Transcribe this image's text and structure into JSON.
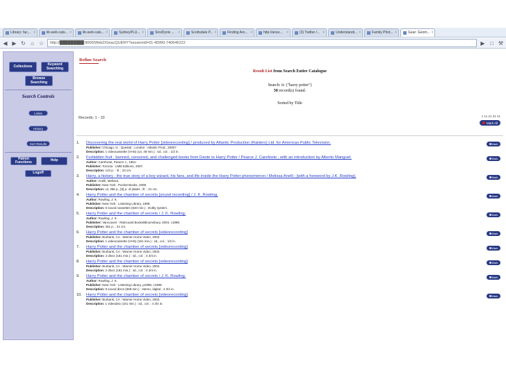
{
  "browser": {
    "tabs": [
      {
        "label": "Library: fac..."
      },
      {
        "label": "lib-web-cats..."
      },
      {
        "label": "lib-web-cats..."
      },
      {
        "label": "SydneyPLU..."
      },
      {
        "label": "SirsiDynix ..."
      },
      {
        "label": "Scottsdale P..."
      },
      {
        "label": "Finding Aro..."
      },
      {
        "label": "http://anso..."
      },
      {
        "label": "(3) Twitter /..."
      },
      {
        "label": "Understandi..."
      },
      {
        "label": "Family Phot..."
      },
      {
        "label": "Gear: Geom..."
      }
    ],
    "address": "http://█████████:8000/WebZ/GeacQUERY?sessionid=01-40990-740646222"
  },
  "sidebar": {
    "collections": "Collections",
    "keyword_searching": "Keyword Searching",
    "browse_searching": "Browse Searching",
    "search_controls": "Search Controls",
    "limits": "Limits",
    "history": "History",
    "sort_results": "Sort Results",
    "patron_functions": "Patron Functions",
    "help": "Help",
    "logoff": "Logoff"
  },
  "main": {
    "refine": "Refine Search",
    "result_list": "Result List",
    "result_suffix": " from Search Entire Catalogue",
    "search_line": "Search: ti: (\"harry potter\")",
    "found_count": "50",
    "found_suffix": " record(s) found.",
    "sorted_by": "Sorted by Title",
    "records_range": "Records: 1 - 10",
    "pages": "1 11 21 31 41",
    "mark_all": "Mark All",
    "mark_label": "Mark"
  },
  "records": [
    {
      "num": "1.",
      "title": "Discovering the real world of Harry Potter [videorecording] / produced by Atlantic Production (Raiders) Ltd. for American Public Television.",
      "lines": [
        {
          "k": "Publisher:",
          "v": " Chicago, IL : Questar ; London : Atlantic Prod., 2000?"
        },
        {
          "k": "Description:",
          "v": " 1 videocassette (VHS) (ca. 48 min.) : sd., col. ; 1/2 in."
        }
      ]
    },
    {
      "num": "2.",
      "title": "Forbidden fruit : banned, censored, and challenged books from Dante to Harry Potter / Pearce J. Carefoote ; with an introduction by Alberto Manguel.",
      "lines": [
        {
          "k": "Author:",
          "v": " Carefoote, Pearce J., 1961-"
        },
        {
          "k": "Publisher:",
          "v": " Toronto : LMB Editions, 2007."
        },
        {
          "k": "Description:",
          "v": " 143 p. : ill. ; 23 cm."
        }
      ]
    },
    {
      "num": "3.",
      "title": "Harry, a history : the true story of a boy wizard, his fans, and life inside the Harry Potter phenomenon / Melissa Anelli ; [with a foreword by J.K. Rowling].",
      "lines": [
        {
          "k": "Author:",
          "v": " Anelli, Melissa."
        },
        {
          "k": "Publisher:",
          "v": " New York : Pocket Books, 2008."
        },
        {
          "k": "Description:",
          "v": " xii, 356 p., [8] p. of plates : ill. ; 21 cm."
        }
      ]
    },
    {
      "num": "4.",
      "title": "Harry Potter and the chamber of secrets [sound recording] / J. K. Rowling.",
      "lines": [
        {
          "k": "Author:",
          "v": " Rowling, J. K."
        },
        {
          "k": "Publisher:",
          "v": " New York : Listening Library, 1999."
        },
        {
          "k": "Description:",
          "v": " 6 sound cassettes (540 min.) : Dolby system."
        }
      ]
    },
    {
      "num": "5.",
      "title": "Harry Potter and the chamber of secrets / J. K. Rowling.",
      "lines": [
        {
          "k": "Author:",
          "v": " Rowling, J. K."
        },
        {
          "k": "Publisher:",
          "v": " Vancouver : Raincoast Books/Bloomsbury, 2004, c1998."
        },
        {
          "k": "Description:",
          "v": " 251 p. ; 21 cm."
        }
      ]
    },
    {
      "num": "6.",
      "title": "Harry Potter and the chamber of secrets [videorecording]",
      "lines": [
        {
          "k": "Publisher:",
          "v": " Burbank, CA : Warner Home Video, 2002."
        },
        {
          "k": "Description:",
          "v": " 1 videocassette (VHS) (161 min.) : sd., col. ; 1/2 in."
        }
      ]
    },
    {
      "num": "7.",
      "title": "Harry Potter and the chamber of secrets [videorecording]",
      "lines": [
        {
          "k": "Publisher:",
          "v": " Burbank, CA : Warner Home Video, 2002."
        },
        {
          "k": "Description:",
          "v": " 2 discs (161 min.) : sd., col. ; 4 3/4 in."
        }
      ]
    },
    {
      "num": "8.",
      "title": "Harry Potter and the chamber of secrets [videorecording]",
      "lines": [
        {
          "k": "Publisher:",
          "v": " Burbank, CA : Warner Home Video, 2002."
        },
        {
          "k": "Description:",
          "v": " 2 discs (161 min.) : sd., col. ; 4 3/4 in."
        }
      ]
    },
    {
      "num": "9.",
      "title": "Harry Potter and the chamber of secrets / J. K. Rowling.",
      "lines": [
        {
          "k": "Author:",
          "v": " Rowling, J. K."
        },
        {
          "k": "Publisher:",
          "v": " New York : Listening Library, p1999, c1999."
        },
        {
          "k": "Description:",
          "v": " 8 sound discs (558 min.) : stereo, digital ; 4 3/4 in."
        }
      ]
    },
    {
      "num": "10.",
      "title": "Harry Potter and the chamber of secrets [videorecording]",
      "lines": [
        {
          "k": "Publisher:",
          "v": " Burbank, CA : Warner Home Video, 2002."
        },
        {
          "k": "Description:",
          "v": " 1 videodisc (161 min.) : sd., col. ; 4 3/4 in."
        }
      ]
    }
  ]
}
